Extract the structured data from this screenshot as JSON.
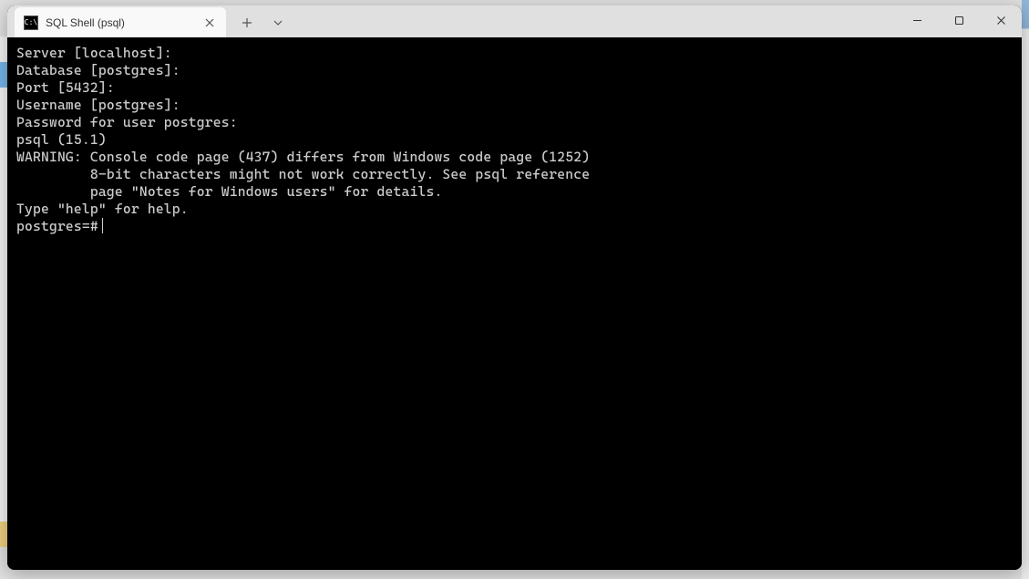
{
  "tab": {
    "title": "SQL Shell (psql)",
    "icon_label": "C:\\"
  },
  "terminal": {
    "lines": [
      "Server [localhost]:",
      "Database [postgres]:",
      "Port [5432]:",
      "Username [postgres]:",
      "Password for user postgres:",
      "psql (15.1)",
      "WARNING: Console code page (437) differs from Windows code page (1252)",
      "         8-bit characters might not work correctly. See psql reference",
      "         page \"Notes for Windows users\" for details.",
      "Type \"help\" for help.",
      ""
    ],
    "prompt": "postgres=#"
  }
}
